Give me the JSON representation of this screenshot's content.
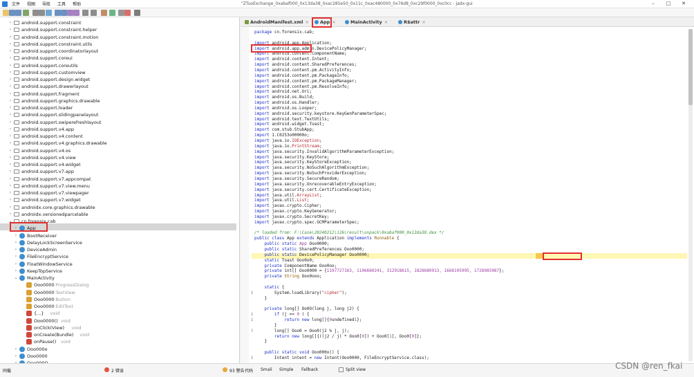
{
  "window": {
    "title": "\"ZTuoExchange_0xabaf000_0x13da38_0xac285e50_0x11c_0xac480000_0x76d8_0xc29f0000_0xc0cc - jadx-gui",
    "controls": [
      "–",
      "□",
      "✕"
    ]
  },
  "menu": [
    "文件",
    "视图",
    "导航",
    "工具",
    "帮助"
  ],
  "toolbar_icons": [
    "open-icon",
    "save-icon",
    "save-all-icon",
    "export-icon",
    "tree-icon",
    "flat-tree-icon",
    "sync-icon",
    "search-icon",
    "find-class-icon",
    "find-usage-icon",
    "goto-icon",
    "back-icon",
    "forward-icon",
    "deobf-icon",
    "quark-icon",
    "log-icon",
    "stop-icon",
    "settings-icon"
  ],
  "tree": [
    {
      "label": "android.support.constraint",
      "level": 1,
      "kind": "pkg"
    },
    {
      "label": "android.support.constraint.helper",
      "level": 1,
      "kind": "pkg"
    },
    {
      "label": "android.support.constraint.motion",
      "level": 1,
      "kind": "pkg"
    },
    {
      "label": "android.support.constraint.utils",
      "level": 1,
      "kind": "pkg"
    },
    {
      "label": "android.support.coordinatorlayout",
      "level": 1,
      "kind": "pkg"
    },
    {
      "label": "android.support.coreui",
      "level": 1,
      "kind": "pkg"
    },
    {
      "label": "android.support.coreutils",
      "level": 1,
      "kind": "pkg"
    },
    {
      "label": "android.support.customview",
      "level": 1,
      "kind": "pkg"
    },
    {
      "label": "android.support.design.widget",
      "level": 1,
      "kind": "pkg"
    },
    {
      "label": "android.support.drawerlayout",
      "level": 1,
      "kind": "pkg"
    },
    {
      "label": "android.support.fragment",
      "level": 1,
      "kind": "pkg"
    },
    {
      "label": "android.support.graphics.drawable",
      "level": 1,
      "kind": "pkg"
    },
    {
      "label": "android.support.loader",
      "level": 1,
      "kind": "pkg"
    },
    {
      "label": "android.support.slidingpanelayout",
      "level": 1,
      "kind": "pkg"
    },
    {
      "label": "android.support.swiperefreshlayout",
      "level": 1,
      "kind": "pkg"
    },
    {
      "label": "android.support.v4.app",
      "level": 1,
      "kind": "pkg"
    },
    {
      "label": "android.support.v4.content",
      "level": 1,
      "kind": "pkg"
    },
    {
      "label": "android.support.v4.graphics.drawable",
      "level": 1,
      "kind": "pkg"
    },
    {
      "label": "android.support.v4.os",
      "level": 1,
      "kind": "pkg"
    },
    {
      "label": "android.support.v4.view",
      "level": 1,
      "kind": "pkg"
    },
    {
      "label": "android.support.v4.widget",
      "level": 1,
      "kind": "pkg"
    },
    {
      "label": "android.support.v7.app",
      "level": 1,
      "kind": "pkg"
    },
    {
      "label": "android.support.v7.appcompat",
      "level": 1,
      "kind": "pkg"
    },
    {
      "label": "android.support.v7.view.menu",
      "level": 1,
      "kind": "pkg"
    },
    {
      "label": "android.support.v7.viewpager",
      "level": 1,
      "kind": "pkg"
    },
    {
      "label": "android.support.v7.widget",
      "level": 1,
      "kind": "pkg"
    },
    {
      "label": "androidx.core.graphics.drawable",
      "level": 1,
      "kind": "pkg"
    },
    {
      "label": "androidx.versionedparcelable",
      "level": 1,
      "kind": "pkg"
    },
    {
      "label": "cn.forensix.cab",
      "level": 1,
      "kind": "pkg",
      "open": true
    },
    {
      "label": "App",
      "level": 2,
      "kind": "cls"
    },
    {
      "label": "BootReceiver",
      "level": 2,
      "kind": "cls"
    },
    {
      "label": "DelayLockScreenService",
      "level": 2,
      "kind": "cls"
    },
    {
      "label": "DeviceAdmin",
      "level": 2,
      "kind": "cls"
    },
    {
      "label": "FileEncryptService",
      "level": 2,
      "kind": "cls"
    },
    {
      "label": "FloatWindowService",
      "level": 2,
      "kind": "cls"
    },
    {
      "label": "KeepTopService",
      "level": 2,
      "kind": "cls"
    },
    {
      "label": "MainActivity",
      "level": 2,
      "kind": "cls",
      "open": true
    },
    {
      "label": "Ooo0000",
      "sub": "ProgressDialog",
      "level": 3,
      "kind": "fld"
    },
    {
      "label": "Ooo0000",
      "sub": "TextView",
      "level": 3,
      "kind": "fld"
    },
    {
      "label": "Ooo0000",
      "sub": "Button",
      "level": 3,
      "kind": "fld"
    },
    {
      "label": "Ooo0000",
      "sub": "EditText",
      "level": 3,
      "kind": "fld"
    },
    {
      "label": "{...}",
      "sub": "void",
      "level": 3,
      "kind": "mth"
    },
    {
      "label": "Ooo0000()",
      "sub": "void",
      "level": 3,
      "kind": "mth"
    },
    {
      "label": "onClick(View)",
      "sub": "void",
      "level": 3,
      "kind": "mth"
    },
    {
      "label": "onCreate(Bundle)",
      "sub": "void",
      "level": 3,
      "kind": "mth"
    },
    {
      "label": "onPause()",
      "sub": "void",
      "level": 3,
      "kind": "mth"
    },
    {
      "label": "Ooo000o",
      "level": 2,
      "kind": "cls"
    },
    {
      "label": "Ooo0000",
      "level": 2,
      "kind": "cls"
    },
    {
      "label": "Ooo000O",
      "level": 2,
      "kind": "cls"
    }
  ],
  "tabs": [
    {
      "label": "AndroidManifest.xml",
      "icon": "xml-file-icon"
    },
    {
      "label": "App",
      "icon": "class-icon",
      "active": true
    },
    {
      "label": "MainActivity",
      "icon": "class-icon"
    },
    {
      "label": "R$attr",
      "icon": "class-icon"
    }
  ],
  "code_lines": [
    {
      "n": "",
      "t": [
        [
          "kw",
          "package"
        ],
        [
          "",
          "cn.forensix.cab;"
        ]
      ]
    },
    {
      "n": "",
      "t": [
        [
          "",
          ""
        ]
      ]
    },
    {
      "n": "",
      "t": [
        [
          "kw",
          "import"
        ],
        [
          "",
          "android.app.Application;"
        ]
      ]
    },
    {
      "n": "",
      "t": [
        [
          "kw",
          "import"
        ],
        [
          "",
          "android.app.admin.DevicePolicyManager;"
        ]
      ]
    },
    {
      "n": "",
      "t": [
        [
          "kw",
          "import"
        ],
        [
          "",
          "android.content.ComponentName;"
        ]
      ]
    },
    {
      "n": "",
      "t": [
        [
          "kw",
          "import"
        ],
        [
          "",
          "android.content.Intent;"
        ]
      ]
    },
    {
      "n": "",
      "t": [
        [
          "kw",
          "import"
        ],
        [
          "",
          "android.content.SharedPreferences;"
        ]
      ]
    },
    {
      "n": "",
      "t": [
        [
          "kw",
          "import"
        ],
        [
          "",
          "android.content.pm.ActivityInfo;"
        ]
      ]
    },
    {
      "n": "",
      "t": [
        [
          "kw",
          "import"
        ],
        [
          "",
          "android.content.pm.PackageInfo;"
        ]
      ]
    },
    {
      "n": "",
      "t": [
        [
          "kw",
          "import"
        ],
        [
          "",
          "android.content.pm.PackageManager;"
        ]
      ]
    },
    {
      "n": "",
      "t": [
        [
          "kw",
          "import"
        ],
        [
          "",
          "android.content.pm.ResolveInfo;"
        ]
      ]
    },
    {
      "n": "",
      "t": [
        [
          "kw",
          "import"
        ],
        [
          "",
          "android.net.Uri;"
        ]
      ]
    },
    {
      "n": "",
      "t": [
        [
          "kw",
          "import"
        ],
        [
          "",
          "android.os.Build;"
        ]
      ]
    },
    {
      "n": "",
      "t": [
        [
          "kw",
          "import"
        ],
        [
          "",
          "android.os.Handler;"
        ]
      ]
    },
    {
      "n": "",
      "t": [
        [
          "kw",
          "import"
        ],
        [
          "",
          "android.os.Looper;"
        ]
      ]
    },
    {
      "n": "",
      "t": [
        [
          "kw",
          "import"
        ],
        [
          "",
          "android.security.keystore.KeyGenParameterSpec;"
        ]
      ]
    },
    {
      "n": "",
      "t": [
        [
          "kw",
          "import"
        ],
        [
          "",
          "android.text.TextUtils;"
        ]
      ]
    },
    {
      "n": "",
      "t": [
        [
          "kw",
          "import"
        ],
        [
          "",
          "android.widget.Toast;"
        ]
      ]
    },
    {
      "n": "",
      "t": [
        [
          "kw",
          "import"
        ],
        [
          "",
          "com.stub.StubApp;"
        ]
      ]
    },
    {
      "n": "",
      "t": [
        [
          "kw",
          "import"
        ],
        [
          "",
          "1.C0253o00000o;"
        ]
      ]
    },
    {
      "n": "",
      "t": [
        [
          "kw",
          "import"
        ],
        [
          "",
          "java.io."
        ],
        [
          "st",
          "IOException"
        ],
        [
          "",
          ";"
        ]
      ]
    },
    {
      "n": "",
      "t": [
        [
          "kw",
          "import"
        ],
        [
          "",
          "java.io."
        ],
        [
          "st",
          "PrintStream"
        ],
        [
          "",
          ";"
        ]
      ]
    },
    {
      "n": "",
      "t": [
        [
          "kw",
          "import"
        ],
        [
          "",
          "java.security.InvalidAlgorithmParameterException;"
        ]
      ]
    },
    {
      "n": "",
      "t": [
        [
          "kw",
          "import"
        ],
        [
          "",
          "java.security.KeyStore;"
        ]
      ]
    },
    {
      "n": "",
      "t": [
        [
          "kw",
          "import"
        ],
        [
          "",
          "java.security.KeyStoreException;"
        ]
      ]
    },
    {
      "n": "",
      "t": [
        [
          "kw",
          "import"
        ],
        [
          "",
          "java.security.NoSuchAlgorithmException;"
        ]
      ]
    },
    {
      "n": "",
      "t": [
        [
          "kw",
          "import"
        ],
        [
          "",
          "java.security.NoSuchProviderException;"
        ]
      ]
    },
    {
      "n": "",
      "t": [
        [
          "kw",
          "import"
        ],
        [
          "",
          "java.security.SecureRandom;"
        ]
      ]
    },
    {
      "n": "",
      "t": [
        [
          "kw",
          "import"
        ],
        [
          "",
          "java.security.UnrecoverableEntryException;"
        ]
      ]
    },
    {
      "n": "",
      "t": [
        [
          "kw",
          "import"
        ],
        [
          "",
          "java.security.cert.CertificateException;"
        ]
      ]
    },
    {
      "n": "",
      "t": [
        [
          "kw",
          "import"
        ],
        [
          "",
          "java.util."
        ],
        [
          "st",
          "ArrayList"
        ],
        [
          "",
          ";"
        ]
      ]
    },
    {
      "n": "",
      "t": [
        [
          "kw",
          "import"
        ],
        [
          "",
          "java.util."
        ],
        [
          "st",
          "List"
        ],
        [
          "",
          ";"
        ]
      ]
    },
    {
      "n": "",
      "t": [
        [
          "kw",
          "import"
        ],
        [
          "",
          "javax.crypto.Cipher;"
        ]
      ]
    },
    {
      "n": "",
      "t": [
        [
          "kw",
          "import"
        ],
        [
          "",
          "javax.crypto.KeyGenerator;"
        ]
      ]
    },
    {
      "n": "",
      "t": [
        [
          "kw",
          "import"
        ],
        [
          "",
          "javax.crypto.SecretKey;"
        ]
      ]
    },
    {
      "n": "",
      "t": [
        [
          "kw",
          "import"
        ],
        [
          "",
          "javax.crypto.spec.GCMParameterSpec;"
        ]
      ]
    },
    {
      "n": "",
      "t": [
        [
          "",
          ""
        ]
      ]
    },
    {
      "n": "",
      "t": [
        [
          "cm",
          "/* loaded from: F:\\Case\\20240212\\126\\result\\unpack\\0xabaf000_0x13da38.dex */"
        ]
      ]
    },
    {
      "n": "",
      "t": [
        [
          "kw",
          "public class "
        ],
        [
          "",
          "App "
        ],
        [
          "kw",
          "extends "
        ],
        [
          "",
          "Application "
        ],
        [
          "kw",
          "implements "
        ],
        [
          "ty",
          "Runnable"
        ],
        [
          "",
          " {"
        ]
      ]
    },
    {
      "n": "",
      "t": [
        [
          "kw",
          "    public static "
        ],
        [
          "nm",
          "App"
        ],
        [
          "",
          " Ooo0000;"
        ]
      ]
    },
    {
      "n": "",
      "t": [
        [
          "kw",
          "    public static "
        ],
        [
          "",
          "SharedPreferences Ooo0000;"
        ]
      ]
    },
    {
      "n": "",
      "t": [
        [
          "kw",
          "    public static "
        ],
        [
          "",
          "DevicePolicyManager Ooo0000;"
        ]
      ]
    },
    {
      "n": "",
      "t": [
        [
          "kw",
          "    static "
        ],
        [
          "",
          "Toast Ooo0o0;"
        ]
      ]
    },
    {
      "n": "",
      "t": [
        [
          "kw",
          "    private "
        ],
        [
          "",
          "ComponentName Ooo0oo;"
        ]
      ]
    },
    {
      "n": "",
      "t": [
        [
          "kw",
          "    private "
        ],
        [
          "",
          "int[] Ooo0000 = {"
        ],
        [
          "nm",
          "1197727163, 1106660241, 312918615, 1828680913, 1668105995, 1728985987"
        ],
        [
          "",
          "};"
        ]
      ]
    },
    {
      "n": "",
      "t": [
        [
          "kw",
          "    private "
        ],
        [
          "ty",
          "String"
        ],
        [
          "",
          " Ooo0ooo;"
        ]
      ]
    },
    {
      "n": "",
      "t": [
        [
          "",
          ""
        ]
      ]
    },
    {
      "n": "",
      "t": [
        [
          "kw",
          "    static "
        ],
        [
          "",
          "{"
        ]
      ]
    },
    {
      "n": "1",
      "t": [
        [
          "",
          "        System.loadLibrary("
        ],
        [
          "st",
          "\"cipher\""
        ],
        [
          "",
          ");"
        ]
      ]
    },
    {
      "n": "",
      "t": [
        [
          "",
          "    }"
        ]
      ]
    },
    {
      "n": "",
      "t": [
        [
          "",
          ""
        ]
      ]
    },
    {
      "n": "",
      "t": [
        [
          "kw",
          "    private "
        ],
        [
          "",
          "long[] Oo0O(long j, long j2) {"
        ]
      ]
    },
    {
      "n": "1",
      "t": [
        [
          "kw",
          "        if "
        ],
        [
          "",
          "(j == "
        ],
        [
          "nm",
          "0"
        ],
        [
          "",
          " ) {"
        ]
      ]
    },
    {
      "n": "1",
      "t": [
        [
          "kw",
          "            return new "
        ],
        [
          "",
          "long[]{"
        ],
        [
          "nm",
          "0"
        ],
        [
          ", "
        ],
        [
          "nm",
          "1"
        ],
        [
          "",
          "};"
        ]
      ]
    },
    {
      "n": "",
      "t": [
        [
          "",
          "        }"
        ]
      ]
    },
    {
      "n": "2",
      "t": [
        [
          "",
          "        long[] Ooo0 = Ooo0(j2 % j, j);"
        ]
      ]
    },
    {
      "n": "",
      "t": [
        [
          "kw",
          "        return new "
        ],
        [
          "",
          "long[]{((j2 / j) * Ooo0["
        ],
        [
          "nm",
          "0"
        ],
        [
          "",
          "]) + Ooo0["
        ],
        [
          "nm",
          "1"
        ],
        [
          "",
          "], Ooo0["
        ],
        [
          "nm",
          "0"
        ],
        [
          "",
          "]};"
        ]
      ]
    },
    {
      "n": "",
      "t": [
        [
          "",
          "    }"
        ]
      ]
    },
    {
      "n": "",
      "t": [
        [
          "",
          ""
        ]
      ]
    },
    {
      "n": "",
      "t": [
        [
          "kw",
          "    public static void "
        ],
        [
          "",
          "Ooo000o() {"
        ]
      ]
    },
    {
      "n": "1",
      "t": [
        [
          "",
          "        Intent intent = "
        ],
        [
          "kw",
          "new "
        ],
        [
          "",
          "Intent(Ooo0000, FileEncryptService.class);"
        ]
      ]
    }
  ],
  "statusbar": {
    "left": "同载",
    "errors": "2 错误",
    "warnings": "93 警告",
    "views": [
      "代码",
      "Smali",
      "Simple",
      "Fallback"
    ],
    "split": "Split view"
  },
  "watermark": "CSDN @ren_fkai",
  "colors": {
    "highlight_red": "#e03030",
    "keyword": "#1a2cc4",
    "string": "#b4232c",
    "selection": "#d6d6d6",
    "class_line": "#fff7b3"
  }
}
